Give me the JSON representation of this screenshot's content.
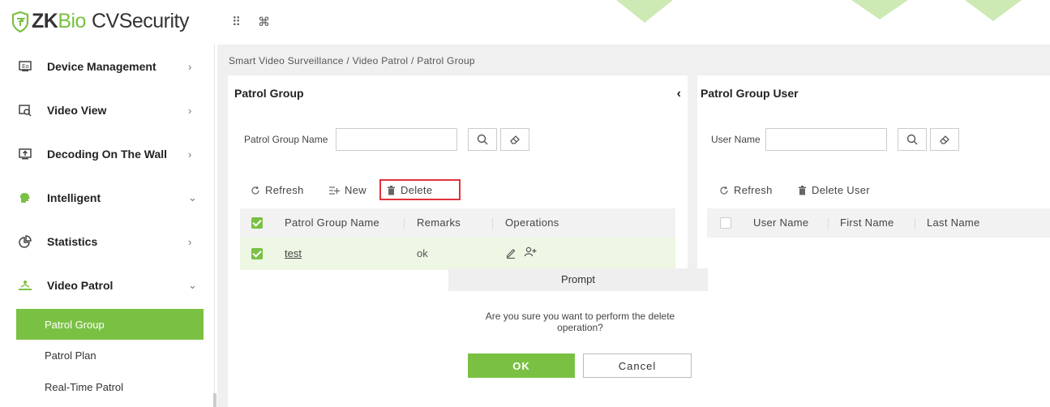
{
  "app": {
    "logo_zk": "ZK",
    "logo_bio": "Bio",
    "logo_cvs": "CVSecurity",
    "accent_color": "#7ac143"
  },
  "topbar": {
    "apps_icon": "⠿",
    "command_icon": "⌘"
  },
  "sidebar": {
    "items": [
      {
        "label": "Device Management",
        "icon": "device-icon",
        "arrow": "›"
      },
      {
        "label": "Video View",
        "icon": "video-view-icon",
        "arrow": "›"
      },
      {
        "label": "Decoding On The Wall",
        "icon": "decoding-icon",
        "arrow": "›"
      },
      {
        "label": "Intelligent",
        "icon": "brain-icon",
        "arrow": "⌄"
      },
      {
        "label": "Statistics",
        "icon": "pie-chart-icon",
        "arrow": "›"
      },
      {
        "label": "Video Patrol",
        "icon": "patrol-icon",
        "arrow": "⌄"
      }
    ],
    "subitems": [
      {
        "label": "Patrol Group",
        "active": true
      },
      {
        "label": "Patrol Plan",
        "active": false
      },
      {
        "label": "Real-Time Patrol",
        "active": false
      }
    ]
  },
  "breadcrumb": "Smart Video Surveillance / Video Patrol / Patrol Group",
  "left_panel": {
    "title": "Patrol Group",
    "collapse_icon": "‹",
    "search_label": "Patrol Group Name",
    "search_value": "",
    "toolbar": {
      "refresh": "Refresh",
      "new": "New",
      "delete": "Delete"
    },
    "columns": [
      "Patrol Group Name",
      "Remarks",
      "Operations"
    ],
    "rows": [
      {
        "name": "test",
        "remarks": "ok",
        "checked": true
      }
    ]
  },
  "right_panel": {
    "title": "Patrol Group User",
    "search_label": "User Name",
    "search_value": "",
    "toolbar": {
      "refresh": "Refresh",
      "delete_user": "Delete User"
    },
    "columns": [
      "User Name",
      "First Name",
      "Last Name"
    ]
  },
  "dialog": {
    "title": "Prompt",
    "message": "Are you sure you want to perform the delete operation?",
    "ok": "OK",
    "cancel": "Cancel"
  }
}
